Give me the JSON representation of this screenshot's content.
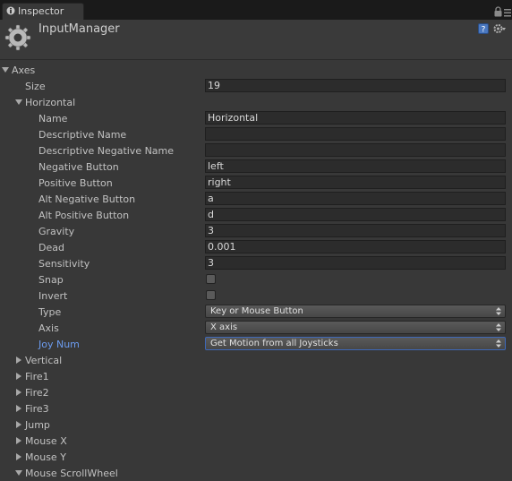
{
  "tab": {
    "label": "Inspector",
    "icon": "info-icon"
  },
  "window_icons": [
    "lock-icon",
    "tab-menu-icon"
  ],
  "header": {
    "title": "InputManager",
    "icon": "gear-icon",
    "help_icon": "help-icon",
    "settings_icon": "settings-icon"
  },
  "axes": {
    "label": "Axes",
    "expanded": true,
    "size_label": "Size",
    "size_value": "19"
  },
  "horizontal": {
    "label": "Horizontal",
    "expanded": true,
    "fields": {
      "name": {
        "label": "Name",
        "value": "Horizontal"
      },
      "descriptive_name": {
        "label": "Descriptive Name",
        "value": ""
      },
      "descriptive_negative_name": {
        "label": "Descriptive Negative Name",
        "value": ""
      },
      "negative_button": {
        "label": "Negative Button",
        "value": "left"
      },
      "positive_button": {
        "label": "Positive Button",
        "value": "right"
      },
      "alt_negative_button": {
        "label": "Alt Negative Button",
        "value": "a"
      },
      "alt_positive_button": {
        "label": "Alt Positive Button",
        "value": "d"
      },
      "gravity": {
        "label": "Gravity",
        "value": "3"
      },
      "dead": {
        "label": "Dead",
        "value": "0.001"
      },
      "sensitivity": {
        "label": "Sensitivity",
        "value": "3"
      },
      "snap": {
        "label": "Snap",
        "checked": false
      },
      "invert": {
        "label": "Invert",
        "checked": false
      },
      "type": {
        "label": "Type",
        "value": "Key or Mouse Button"
      },
      "axis": {
        "label": "Axis",
        "value": "X axis"
      },
      "joy_num": {
        "label": "Joy Num",
        "value": "Get Motion from all Joysticks",
        "focused": true
      }
    }
  },
  "collapsed_axes": [
    "Vertical",
    "Fire1",
    "Fire2",
    "Fire3",
    "Jump",
    "Mouse X",
    "Mouse Y"
  ],
  "last_axis": {
    "label": "Mouse ScrollWheel",
    "expanded": true
  },
  "colors": {
    "background": "#383838",
    "tab_bar": "#1a1a1a",
    "field_bg": "#2c2c2c",
    "active_label": "#6c9cf0",
    "text": "#c2c2c2"
  }
}
